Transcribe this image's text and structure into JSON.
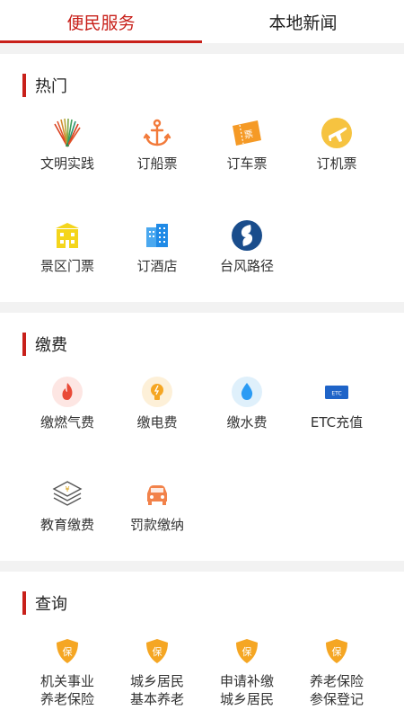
{
  "tabs": [
    {
      "label": "便民服务",
      "active": true
    },
    {
      "label": "本地新闻",
      "active": false
    }
  ],
  "sections": [
    {
      "title": "热门",
      "items": [
        {
          "label": "文明实践",
          "icon": "fan-emblem-icon"
        },
        {
          "label": "订船票",
          "icon": "anchor-icon"
        },
        {
          "label": "订车票",
          "icon": "ticket-icon"
        },
        {
          "label": "订机票",
          "icon": "airplane-icon"
        },
        {
          "label": "景区门票",
          "icon": "building-icon"
        },
        {
          "label": "订酒店",
          "icon": "hotel-icon"
        },
        {
          "label": "台风路径",
          "icon": "typhoon-icon"
        }
      ]
    },
    {
      "title": "缴费",
      "items": [
        {
          "label": "缴燃气费",
          "icon": "flame-icon"
        },
        {
          "label": "缴电费",
          "icon": "bulb-icon"
        },
        {
          "label": "缴水费",
          "icon": "water-drop-icon"
        },
        {
          "label": "ETC充值",
          "icon": "etc-card-icon"
        },
        {
          "label": "教育缴费",
          "icon": "education-fee-icon"
        },
        {
          "label": "罚款缴纳",
          "icon": "car-icon"
        }
      ]
    },
    {
      "title": "查询",
      "items": [
        {
          "line1": "机关事业",
          "line2": "养老保险",
          "icon": "shield-icon",
          "badge": "保"
        },
        {
          "line1": "城乡居民",
          "line2": "基本养老",
          "icon": "shield-icon",
          "badge": "保"
        },
        {
          "line1": "申请补缴",
          "line2": "城乡居民",
          "icon": "shield-icon",
          "badge": "保"
        },
        {
          "line1": "养老保险",
          "line2": "参保登记",
          "icon": "shield-icon",
          "badge": "保"
        }
      ]
    }
  ],
  "icon_texts": {
    "ticket": "票",
    "etc": "ETC",
    "yuan": "¥"
  },
  "colors": {
    "accent": "#c8201a",
    "orange": "#f27a3a",
    "yellow": "#f6c340",
    "blue": "#2b9bf4",
    "navy": "#1a4d8c"
  }
}
